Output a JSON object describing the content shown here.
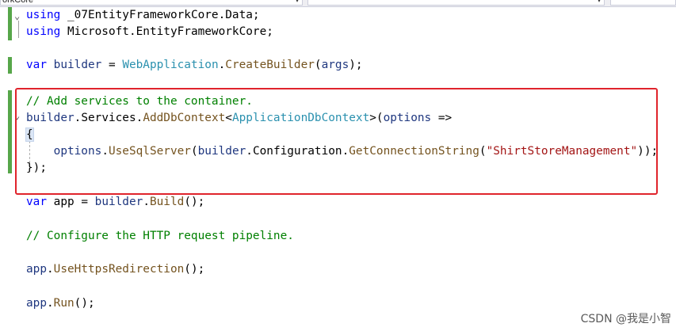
{
  "toolbar": {
    "project_dropdown": "orkCore",
    "dropdown_arrow": "▾"
  },
  "icons": {
    "fold_expanded": "chevron-down-icon",
    "dropdown": "chevron-down-icon"
  },
  "colors": {
    "keyword": "#0000ff",
    "type": "#2b91af",
    "comment": "#008000",
    "string": "#a31515",
    "change_bar": "#57a64a",
    "highlight_box": "#e0242c"
  },
  "code": {
    "l1": {
      "kw": "using",
      "rest": " _07EntityFrameworkCore.Data;"
    },
    "l2": {
      "kw": "using",
      "rest": " Microsoft.EntityFrameworkCore;"
    },
    "l4": {
      "kw": "var",
      "var": " builder",
      "eq": " = ",
      "cls": "WebApplication",
      "dot": ".",
      "mth": "CreateBuilder",
      "open": "(",
      "arg": "args",
      "close": ");"
    },
    "l6": "// Add services to the container.",
    "l7": {
      "p1": "builder",
      "p2": ".",
      "p3": "Services",
      "p4": ".",
      "p5": "AddDbContext",
      "p6": "<",
      "p7": "ApplicationDbContext",
      "p8": ">(",
      "p9": "options",
      "p10": " =>"
    },
    "l8": "{",
    "l9": {
      "p1": "    options",
      "p2": ".",
      "p3": "UseSqlServer",
      "p4": "(",
      "p5": "builder",
      "p6": ".",
      "p7": "Configuration",
      "p8": ".",
      "p9": "GetConnectionString",
      "p10": "(",
      "p11": "\"ShirtStoreManagement\"",
      "p12": "));"
    },
    "l10": "});",
    "l12": {
      "kw": "var",
      "rest1": " app = ",
      "p1": "builder",
      "p2": ".",
      "p3": "Build",
      "p4": "();"
    },
    "l14": "// Configure the HTTP request pipeline.",
    "l16": {
      "p1": "app",
      "p2": ".",
      "p3": "UseHttpsRedirection",
      "p4": "();"
    },
    "l18": {
      "p1": "app",
      "p2": ".",
      "p3": "Run",
      "p4": "();"
    }
  },
  "watermark": "CSDN @我是小智"
}
